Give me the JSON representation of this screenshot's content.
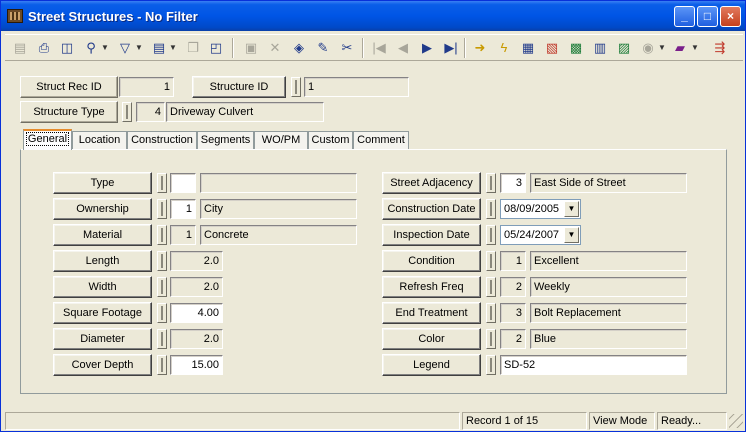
{
  "window": {
    "title": "Street Structures - No Filter"
  },
  "title_buttons": {
    "minimize": "_",
    "maximize": "□",
    "close": "×"
  },
  "toolbar": {
    "icons": {
      "new": "▤",
      "print": "⎙",
      "preview": "◫",
      "find": "⚲",
      "filter": "▽",
      "report": "▤",
      "copy": "❐",
      "paste": "◰",
      "save": "▣",
      "delete": "✕",
      "layers": "◈",
      "edit": "✎",
      "cut": "✂",
      "first": "|◀",
      "prev": "◀",
      "next": "▶",
      "last": "▶|",
      "goto": "➜",
      "zap": "ϟ",
      "map1": "▦",
      "map2": "▧",
      "map3": "▩",
      "calc": "▥",
      "map4": "▨",
      "globe": "◉",
      "book": "▰",
      "exit": "⇶"
    }
  },
  "header": {
    "struct_rec_id_label": "Struct Rec ID",
    "struct_rec_id_value": "1",
    "structure_id_label": "Structure ID",
    "structure_id_value": "1",
    "structure_type_label": "Structure Type",
    "structure_type_code": "4",
    "structure_type_desc": "Driveway Culvert"
  },
  "tabs": [
    "General",
    "Location",
    "Construction",
    "Segments",
    "WO/PM",
    "Custom",
    "Comment"
  ],
  "left": {
    "type": {
      "label": "Type",
      "code": "",
      "desc": ""
    },
    "ownership": {
      "label": "Ownership",
      "code": "1",
      "desc": "City"
    },
    "material": {
      "label": "Material",
      "code": "1",
      "desc": "Concrete"
    },
    "length": {
      "label": "Length",
      "value": "2.0"
    },
    "width": {
      "label": "Width",
      "value": "2.0"
    },
    "square_footage": {
      "label": "Square Footage",
      "value": "4.00"
    },
    "diameter": {
      "label": "Diameter",
      "value": "2.0"
    },
    "cover_depth": {
      "label": "Cover Depth",
      "value": "15.00"
    }
  },
  "right": {
    "street_adjacency": {
      "label": "Street Adjacency",
      "code": "3",
      "desc": "East Side of Street"
    },
    "construction_date": {
      "label": "Construction Date",
      "value": "08/09/2005"
    },
    "inspection_date": {
      "label": "Inspection Date",
      "value": "05/24/2007"
    },
    "condition": {
      "label": "Condition",
      "code": "1",
      "desc": "Excellent"
    },
    "refresh_freq": {
      "label": "Refresh Freq",
      "code": "2",
      "desc": "Weekly"
    },
    "end_treatment": {
      "label": "End Treatment",
      "code": "3",
      "desc": "Bolt Replacement"
    },
    "color": {
      "label": "Color",
      "code": "2",
      "desc": "Blue"
    },
    "legend": {
      "label": "Legend",
      "value": "SD-52"
    }
  },
  "status": {
    "record": "Record 1 of 15",
    "mode": "View Mode",
    "state": "Ready..."
  }
}
